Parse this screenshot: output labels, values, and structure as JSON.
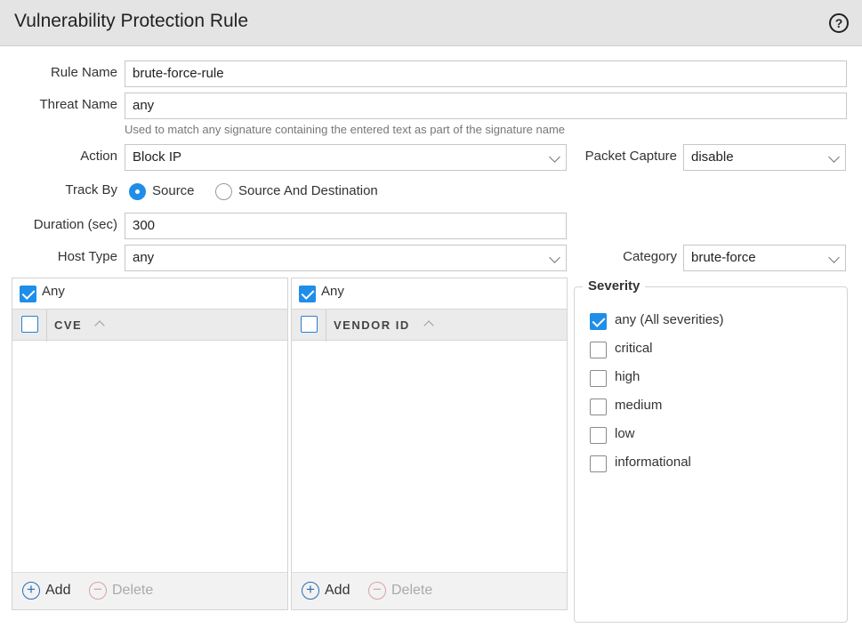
{
  "dialog": {
    "title": "Vulnerability Protection Rule"
  },
  "form": {
    "rule_name_label": "Rule Name",
    "rule_name_value": "brute-force-rule",
    "threat_name_label": "Threat Name",
    "threat_name_value": "any",
    "threat_name_hint": "Used to match any signature containing the entered text as part of the signature name",
    "action_label": "Action",
    "action_value": "Block IP",
    "packet_capture_label": "Packet Capture",
    "packet_capture_value": "disable",
    "track_by_label": "Track By",
    "track_by_options": [
      {
        "label": "Source",
        "selected": true
      },
      {
        "label": "Source And Destination",
        "selected": false
      }
    ],
    "duration_label": "Duration (sec)",
    "duration_value": "300",
    "host_type_label": "Host Type",
    "host_type_value": "any",
    "category_label": "Category",
    "category_value": "brute-force"
  },
  "cve_panel": {
    "any_label": "Any",
    "any_checked": true,
    "column_header": "CVE",
    "add_label": "Add",
    "delete_label": "Delete"
  },
  "vendor_panel": {
    "any_label": "Any",
    "any_checked": true,
    "column_header": "VENDOR ID",
    "add_label": "Add",
    "delete_label": "Delete"
  },
  "severity": {
    "legend": "Severity",
    "items": [
      {
        "label": "any (All severities)",
        "checked": true
      },
      {
        "label": "critical",
        "checked": false
      },
      {
        "label": "high",
        "checked": false
      },
      {
        "label": "medium",
        "checked": false
      },
      {
        "label": "low",
        "checked": false
      },
      {
        "label": "informational",
        "checked": false
      }
    ]
  },
  "colors": {
    "accent": "#1f8ee8",
    "titlebar": "#e4e4e4"
  }
}
